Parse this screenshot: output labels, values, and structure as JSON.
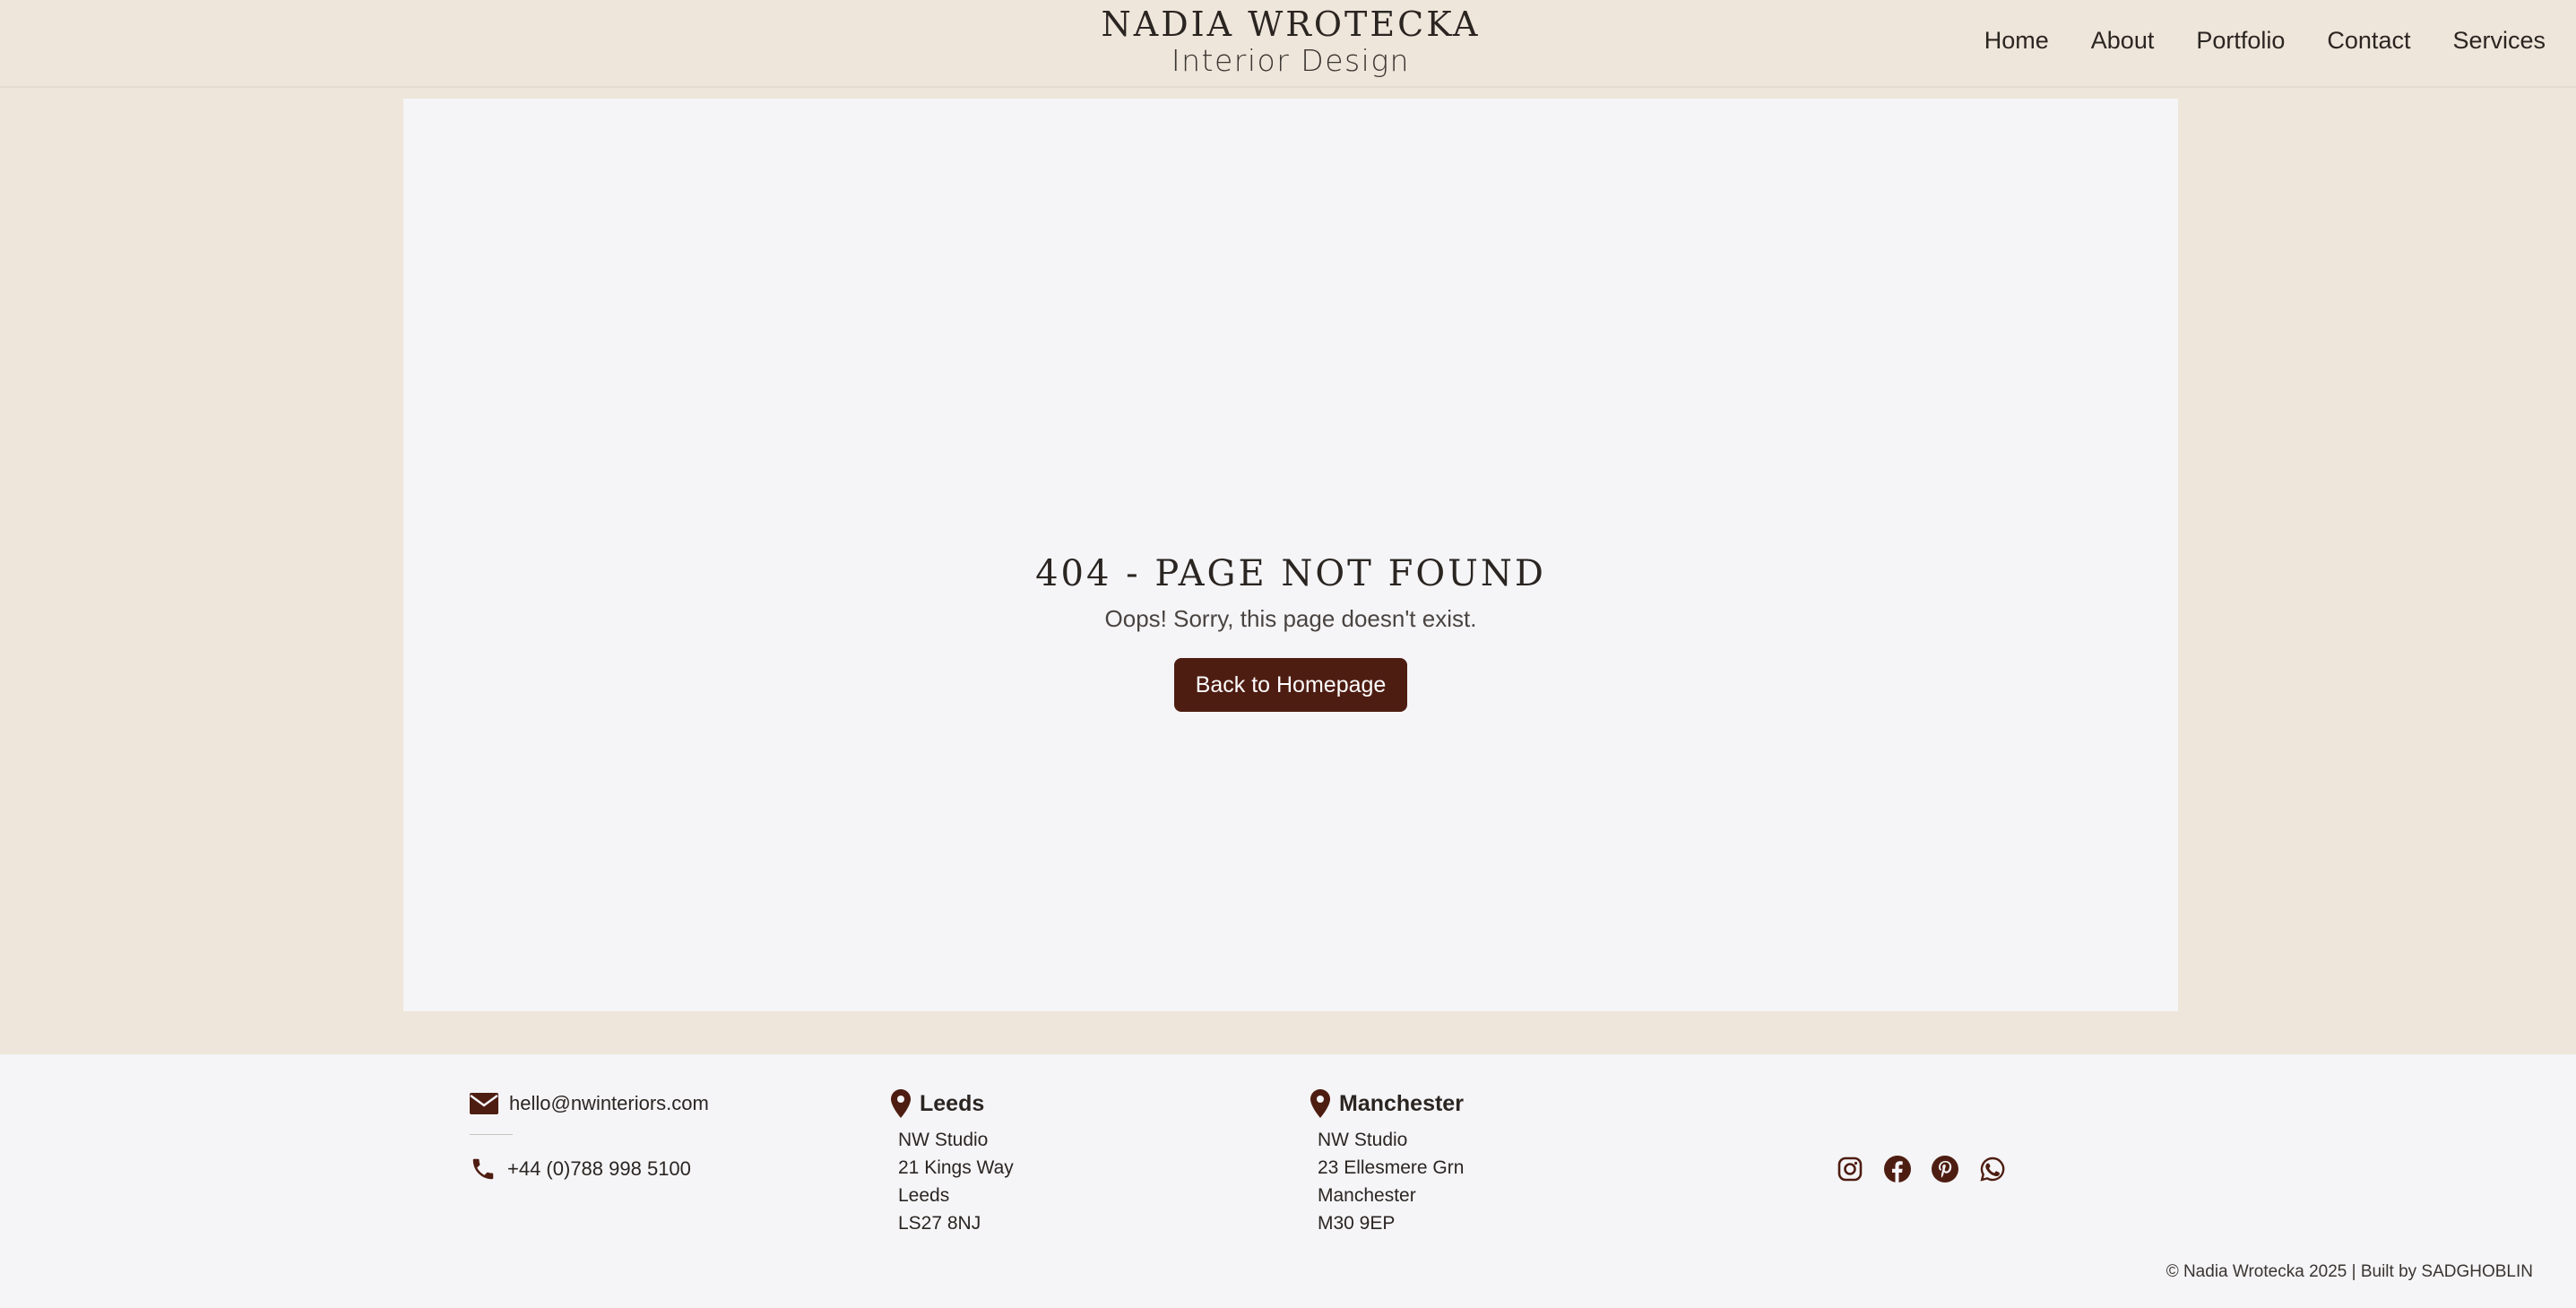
{
  "brand": {
    "name": "NADIA WROTECKA",
    "subtitle": "Interior Design"
  },
  "nav": {
    "items": [
      {
        "label": "Home"
      },
      {
        "label": "About"
      },
      {
        "label": "Portfolio"
      },
      {
        "label": "Contact"
      },
      {
        "label": "Services"
      }
    ]
  },
  "error": {
    "title": "404 - PAGE NOT FOUND",
    "message": "Oops! Sorry, this page doesn't exist.",
    "button_label": "Back to Homepage"
  },
  "footer": {
    "email": "hello@nwinteriors.com",
    "phone": "+44 (0)788 998 5100",
    "locations": [
      {
        "title": "Leeds",
        "lines": [
          "NW Studio",
          "21 Kings Way",
          "Leeds",
          "LS27 8NJ"
        ]
      },
      {
        "title": "Manchester",
        "lines": [
          "NW Studio",
          "23 Ellesmere Grn",
          "Manchester",
          "M30 9EP"
        ]
      }
    ],
    "social": [
      "instagram-icon",
      "facebook-icon",
      "pinterest-icon",
      "whatsapp-icon"
    ],
    "copyright": "© Nadia Wrotecka 2025 | Built by SADGHOBLIN"
  },
  "colors": {
    "background": "#eee6da",
    "card": "#f5f5f7",
    "accent": "#4e1d12",
    "text": "#2b2522"
  }
}
